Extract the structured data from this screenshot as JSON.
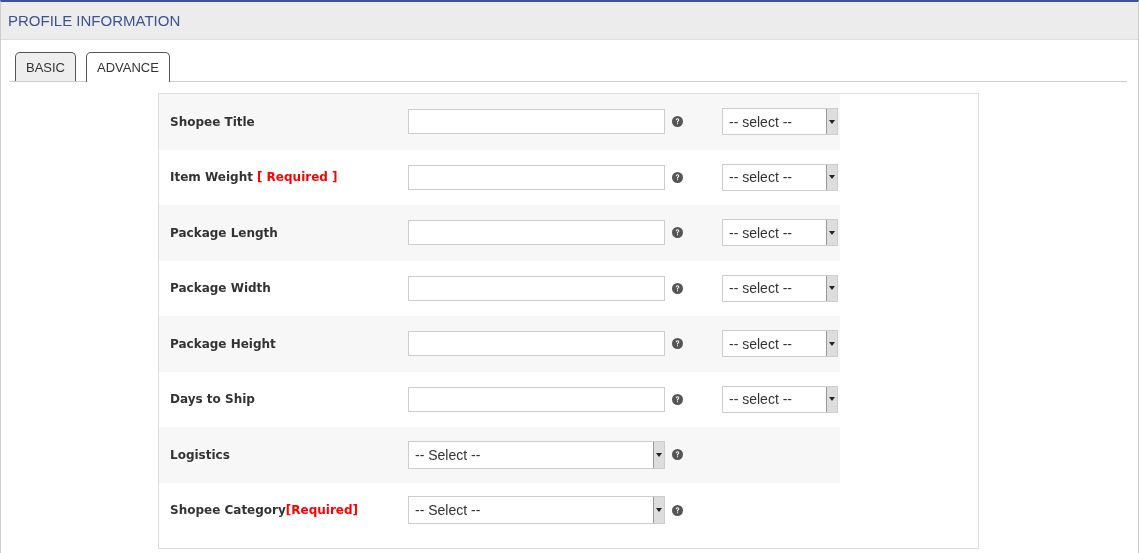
{
  "header": {
    "title": "PROFILE INFORMATION"
  },
  "tabs": [
    {
      "label": "BASIC",
      "selected": false
    },
    {
      "label": "ADVANCE",
      "selected": true
    }
  ],
  "rows": [
    {
      "kind": "text",
      "label": "Shopee Title",
      "select": "-- select --"
    },
    {
      "kind": "text",
      "label": "Item Weight",
      "required": "[ Required ]",
      "separated": true,
      "select": "-- select --"
    },
    {
      "kind": "text",
      "label": "Package Length",
      "select": "-- select --"
    },
    {
      "kind": "text",
      "label": "Package Width",
      "select": "-- select --"
    },
    {
      "kind": "text",
      "label": "Package Height",
      "select": "-- select --"
    },
    {
      "kind": "text",
      "label": "Days to Ship",
      "select": "-- select --"
    },
    {
      "kind": "select",
      "label": "Logistics",
      "select": "-- Select --"
    },
    {
      "kind": "select",
      "label": "Shopee Category",
      "required": "[Required]",
      "separated": false,
      "select": "-- Select --"
    }
  ]
}
